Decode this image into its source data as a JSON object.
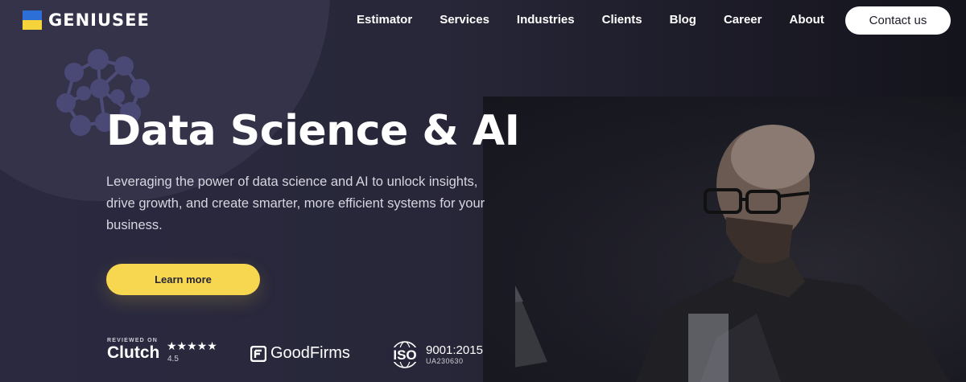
{
  "header": {
    "logo_text": "GENIUSEE",
    "nav": [
      "Estimator",
      "Services",
      "Industries",
      "Clients",
      "Blog",
      "Career",
      "About"
    ],
    "contact_label": "Contact us"
  },
  "hero": {
    "title": "Data Science & AI",
    "subtitle": "Leveraging the power of data science and AI to unlock insights, drive growth, and create smarter, more efficient systems for your business.",
    "cta_label": "Learn more"
  },
  "badges": {
    "clutch_reviewed": "REVIEWED ON",
    "clutch_name": "Clutch",
    "clutch_rating": "4.5",
    "clutch_stars": 5,
    "goodfirms_name": "GoodFirms",
    "iso_label": "ISO",
    "iso_standard": "9001:2015",
    "iso_code": "UA230630"
  },
  "colors": {
    "accent": "#f7d74f",
    "background": "#26253a",
    "flag_blue": "#2c6fd7",
    "flag_yellow": "#f6d33a"
  }
}
